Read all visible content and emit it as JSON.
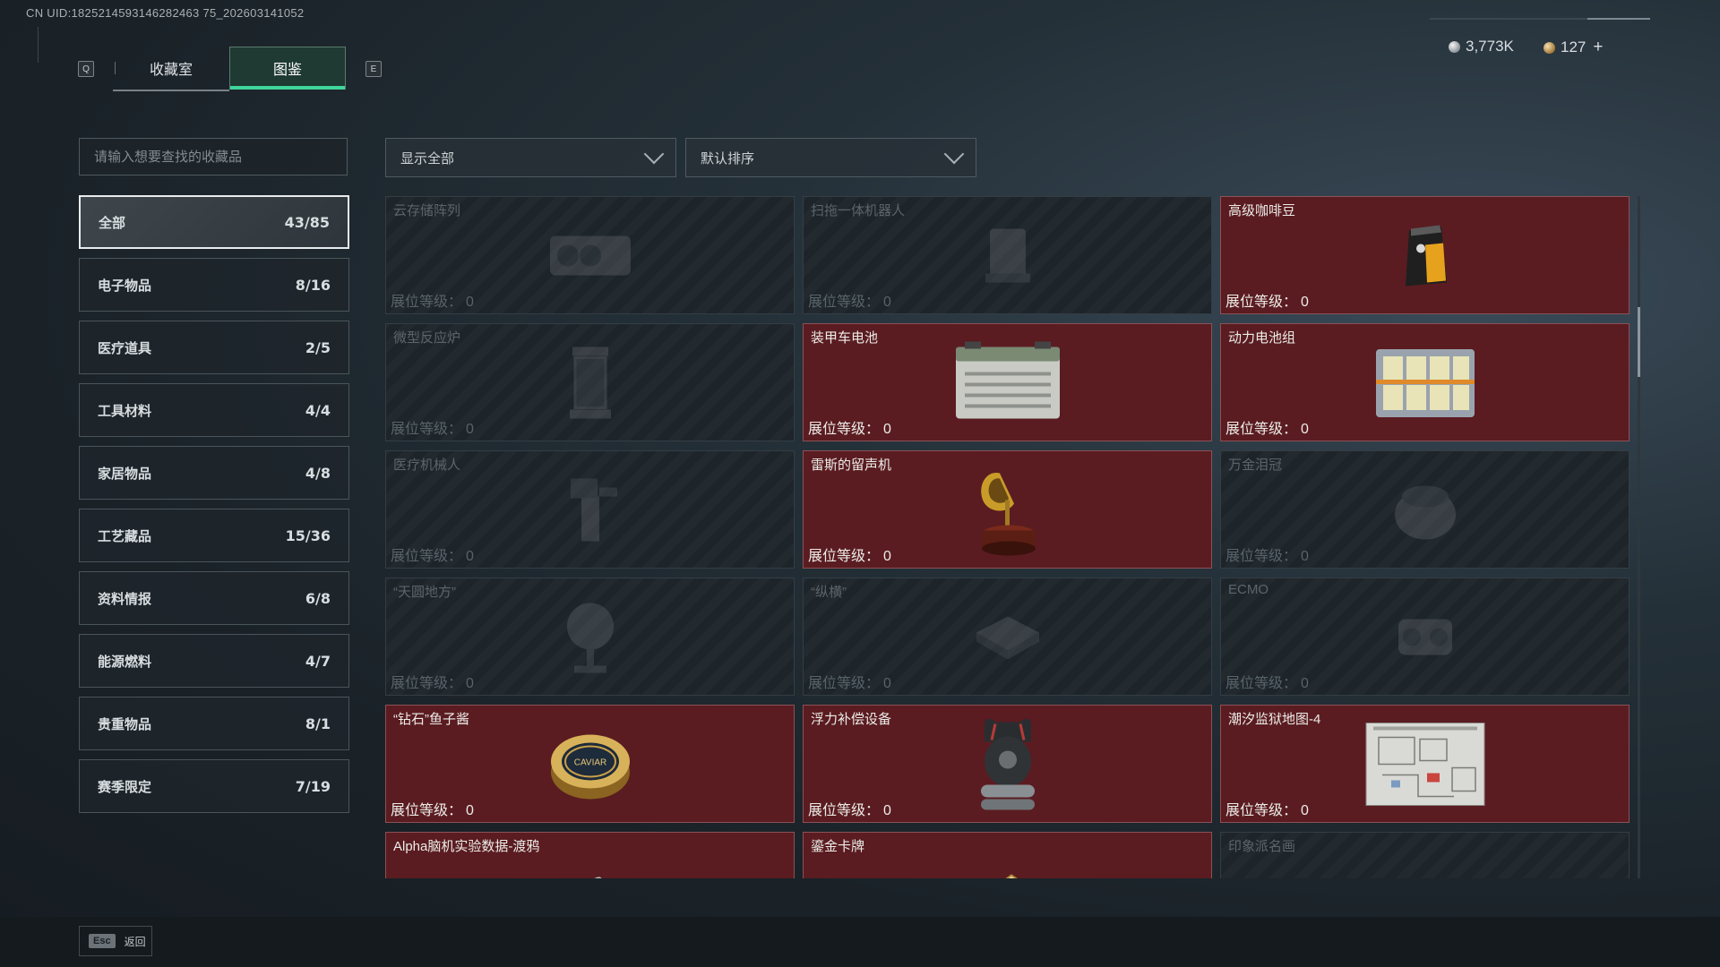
{
  "uid": "CN UID:1825214593146282463 75_202603141052",
  "tabs": {
    "key_left": "Q",
    "key_right": "E",
    "collection_room": "收藏室",
    "encyclopedia": "图鉴"
  },
  "currency": {
    "silver": "3,773K",
    "gold": "127",
    "plus": "+"
  },
  "search": {
    "placeholder": "请输入想要查找的收藏品"
  },
  "filters": {
    "display": "显示全部",
    "sort": "默认排序"
  },
  "categories": [
    {
      "label": "全部",
      "count": "43/85"
    },
    {
      "label": "电子物品",
      "count": "8/16"
    },
    {
      "label": "医疗道具",
      "count": "2/5"
    },
    {
      "label": "工具材料",
      "count": "4/4"
    },
    {
      "label": "家居物品",
      "count": "4/8"
    },
    {
      "label": "工艺藏品",
      "count": "15/36"
    },
    {
      "label": "资料情报",
      "count": "6/8"
    },
    {
      "label": "能源燃料",
      "count": "4/7"
    },
    {
      "label": "贵重物品",
      "count": "8/1"
    },
    {
      "label": "赛季限定",
      "count": "7/19"
    }
  ],
  "level_label": "展位等级：",
  "items": [
    {
      "name": "云存储阵列",
      "level": "0",
      "owned": false,
      "icon": "server-array-icon"
    },
    {
      "name": "扫拖一体机器人",
      "level": "0",
      "owned": false,
      "icon": "robot-vacuum-icon"
    },
    {
      "name": "高级咖啡豆",
      "level": "0",
      "owned": true,
      "icon": "coffee-bag-icon"
    },
    {
      "name": "微型反应炉",
      "level": "0",
      "owned": false,
      "icon": "reactor-icon"
    },
    {
      "name": "装甲车电池",
      "level": "0",
      "owned": true,
      "icon": "car-battery-icon"
    },
    {
      "name": "动力电池组",
      "level": "0",
      "owned": true,
      "icon": "battery-pack-icon"
    },
    {
      "name": "医疗机械人",
      "level": "0",
      "owned": false,
      "icon": "medical-robot-icon"
    },
    {
      "name": "雷斯的留声机",
      "level": "0",
      "owned": true,
      "icon": "gramophone-icon"
    },
    {
      "name": "万金泪冠",
      "level": "0",
      "owned": false,
      "icon": "crown-icon"
    },
    {
      "name": "“天圆地方”",
      "level": "0",
      "owned": false,
      "icon": "globe-icon"
    },
    {
      "name": "“纵横”",
      "level": "0",
      "owned": false,
      "icon": "chessboard-icon"
    },
    {
      "name": "ECMO",
      "level": "0",
      "owned": false,
      "icon": "ecmo-icon"
    },
    {
      "name": "“钻石”鱼子酱",
      "level": "0",
      "owned": true,
      "icon": "caviar-tin-icon"
    },
    {
      "name": "浮力补偿设备",
      "level": "0",
      "owned": true,
      "icon": "buoyancy-device-icon"
    },
    {
      "name": "潮汐监狱地图-4",
      "level": "0",
      "owned": true,
      "icon": "prison-map-icon"
    },
    {
      "name": "Alpha脑机实验数据-渡鸦",
      "level": "",
      "owned": true,
      "icon": "data-drive-icon"
    },
    {
      "name": "鎏金卡牌",
      "level": "",
      "owned": true,
      "icon": "gilded-card-icon"
    },
    {
      "name": "印象派名画",
      "level": "",
      "owned": false,
      "icon": "painting-icon"
    }
  ],
  "caviar_label": "CAVIAR",
  "footer": {
    "key": "Esc",
    "label": "返回"
  },
  "colors": {
    "accent": "#3fd69c",
    "owned_card": "#5a1c21",
    "locked_card": "#1d252b"
  }
}
